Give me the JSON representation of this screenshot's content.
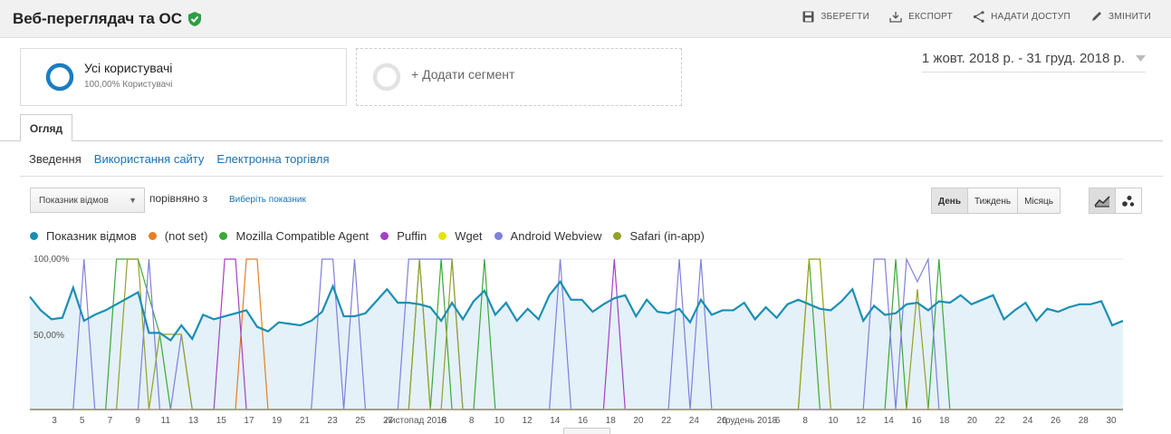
{
  "header": {
    "title": "Веб-переглядач та ОС",
    "actions": {
      "save": "ЗБЕРЕГТИ",
      "export": "ЕКСПОРТ",
      "share": "НАДАТИ ДОСТУП",
      "edit": "ЗМІНИТИ"
    }
  },
  "segments": {
    "active_name": "Усі користувачі",
    "active_sub": "100,00% Користувачі",
    "add_label": "+ Додати сегмент"
  },
  "daterange": "1 жовт. 2018 р. - 31 груд. 2018 р.",
  "tab": "Огляд",
  "subnav": {
    "summary": "Зведення",
    "usage": "Використання сайту",
    "ecommerce": "Електронна торгівля"
  },
  "controls": {
    "metric": "Показник відмов",
    "compare": "порівняно з",
    "pick": "Виберіть показник",
    "day": "День",
    "week": "Тиждень",
    "month": "Місяць"
  },
  "colors": {
    "accent": "#1a73b8",
    "primary_line": "#0f8fb0"
  },
  "chart_data": {
    "type": "line",
    "ylim": [
      0,
      100
    ],
    "yticks": [
      "100,00%",
      "50,00%"
    ],
    "x_ticks": [
      "3",
      "5",
      "7",
      "9",
      "11",
      "13",
      "15",
      "17",
      "19",
      "21",
      "23",
      "25",
      "27",
      "листопад 2018",
      "6",
      "8",
      "10",
      "12",
      "14",
      "16",
      "18",
      "20",
      "22",
      "24",
      "26",
      "грудень 2018",
      "6",
      "8",
      "10",
      "12",
      "14",
      "16",
      "18",
      "20",
      "22",
      "24",
      "26",
      "28",
      "30"
    ],
    "series": [
      {
        "name": "Показник відмов",
        "color": "#1a8fb3",
        "values": [
          75,
          66,
          60,
          61,
          81,
          59,
          63,
          66,
          70,
          74,
          78,
          51,
          51,
          46,
          56,
          47,
          63,
          60,
          62,
          64,
          66,
          55,
          52,
          58,
          57,
          56,
          59,
          65,
          82,
          62,
          62,
          64,
          72,
          80,
          71,
          71,
          70,
          68,
          59,
          71,
          60,
          72,
          79,
          63,
          71,
          59,
          67,
          60,
          76,
          85,
          73,
          73,
          65,
          70,
          74,
          76,
          62,
          73,
          65,
          64,
          67,
          58,
          73,
          63,
          66,
          66,
          71,
          60,
          68,
          61,
          70,
          73,
          70,
          67,
          66,
          72,
          80,
          59,
          69,
          63,
          64,
          70,
          71,
          66,
          72,
          71,
          76,
          70,
          73,
          76,
          60,
          66,
          71,
          59,
          67,
          65,
          68,
          70,
          70,
          72,
          56,
          59
        ]
      },
      {
        "name": "(not set)",
        "color": "#e67e22",
        "spikes": [
          [
            20,
            100
          ],
          [
            21,
            100
          ]
        ]
      },
      {
        "name": "Mozilla Compatible Agent",
        "color": "#3aa93a",
        "spikes": [
          [
            8,
            100
          ],
          [
            9,
            100
          ],
          [
            10,
            100
          ],
          [
            11,
            75
          ],
          [
            12,
            50
          ],
          [
            36,
            100
          ],
          [
            38,
            100
          ],
          [
            42,
            100
          ],
          [
            72,
            100
          ],
          [
            80,
            100
          ],
          [
            84,
            100
          ]
        ]
      },
      {
        "name": "Puffin",
        "color": "#a341c4",
        "spikes": [
          [
            18,
            100
          ],
          [
            19,
            100
          ],
          [
            54,
            100
          ]
        ]
      },
      {
        "name": "Wget",
        "color": "#e4e412",
        "spikes": [
          [
            72,
            100
          ],
          [
            73,
            100
          ]
        ]
      },
      {
        "name": "Android Webview",
        "color": "#7f7fdd",
        "spikes": [
          [
            5,
            100
          ],
          [
            11,
            100
          ],
          [
            14,
            50
          ],
          [
            27,
            100
          ],
          [
            28,
            100
          ],
          [
            30,
            100
          ],
          [
            35,
            100
          ],
          [
            36,
            100
          ],
          [
            37,
            100
          ],
          [
            38,
            100
          ],
          [
            39,
            100
          ],
          [
            49,
            100
          ],
          [
            60,
            100
          ],
          [
            62,
            100
          ],
          [
            78,
            100
          ],
          [
            79,
            100
          ],
          [
            81,
            100
          ],
          [
            82,
            85
          ],
          [
            83,
            100
          ]
        ]
      },
      {
        "name": "Safari (in-app)",
        "color": "#95a02a",
        "spikes": [
          [
            9,
            100
          ],
          [
            10,
            100
          ],
          [
            12,
            50
          ],
          [
            13,
            50
          ],
          [
            14,
            50
          ],
          [
            36,
            100
          ],
          [
            39,
            100
          ],
          [
            72,
            100
          ],
          [
            73,
            100
          ],
          [
            82,
            80
          ]
        ]
      }
    ]
  }
}
